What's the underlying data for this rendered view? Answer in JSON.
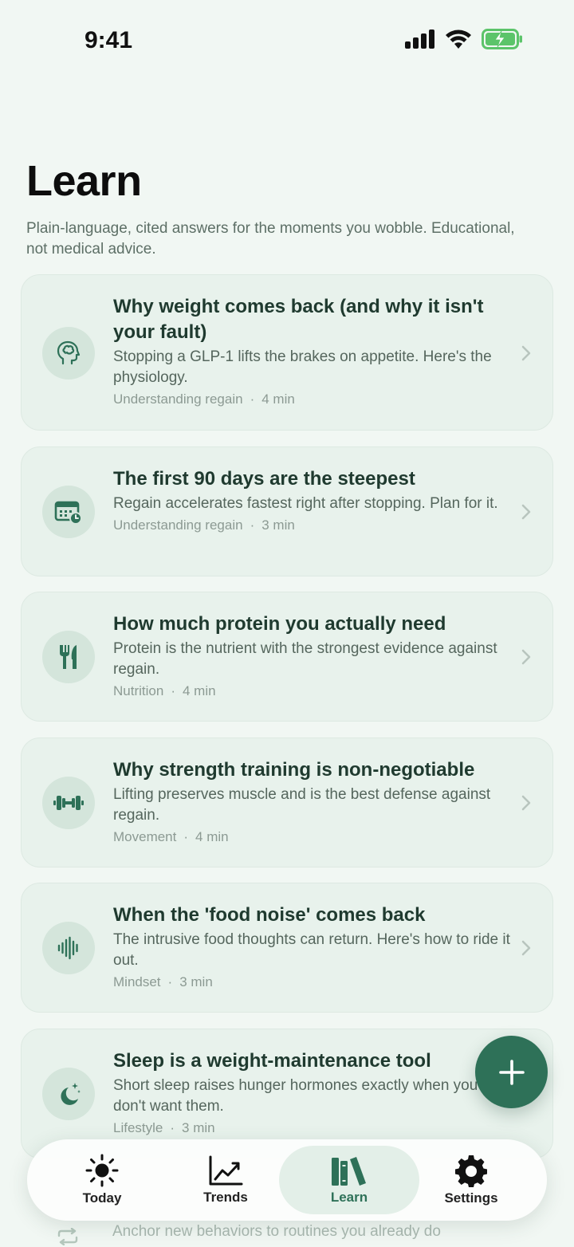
{
  "status": {
    "time": "9:41"
  },
  "header": {
    "title": "Learn",
    "subtitle": "Plain-language, cited answers for the moments you wobble. Educational, not medical advice."
  },
  "articles": [
    {
      "icon": "brain-head-icon",
      "title": "Why weight comes back (and why it isn't your fault)",
      "description": "Stopping a GLP-1 lifts the brakes on appetite. Here's the physiology.",
      "category": "Understanding regain",
      "duration": "4 min"
    },
    {
      "icon": "calendar-clock-icon",
      "title": "The first 90 days are the steepest",
      "description": "Regain accelerates fastest right after stopping. Plan for it.",
      "category": "Understanding regain",
      "duration": "3 min"
    },
    {
      "icon": "fork-knife-icon",
      "title": "How much protein you actually need",
      "description": "Protein is the nutrient with the strongest evidence against regain.",
      "category": "Nutrition",
      "duration": "4 min"
    },
    {
      "icon": "dumbbell-icon",
      "title": "Why strength training is non-negotiable",
      "description": "Lifting preserves muscle and is the best defense against regain.",
      "category": "Movement",
      "duration": "4 min"
    },
    {
      "icon": "waveform-icon",
      "title": "When the 'food noise' comes back",
      "description": "The intrusive food thoughts can return. Here's how to ride it out.",
      "category": "Mindset",
      "duration": "3 min"
    },
    {
      "icon": "moon-stars-icon",
      "title": "Sleep is a weight-maintenance tool",
      "description": "Short sleep raises hunger hormones exactly when you don't want them.",
      "category": "Lifestyle",
      "duration": "3 min"
    }
  ],
  "peek": {
    "description": "Anchor new behaviors to routines you already do",
    "icon": "repeat-icon"
  },
  "tabs": [
    {
      "label": "Today",
      "icon": "sun-icon",
      "active": false
    },
    {
      "label": "Trends",
      "icon": "chart-line-icon",
      "active": false
    },
    {
      "label": "Learn",
      "icon": "books-icon",
      "active": true
    },
    {
      "label": "Settings",
      "icon": "gear-icon",
      "active": false
    }
  ],
  "fab": {
    "icon": "plus-icon"
  },
  "colors": {
    "accent": "#2e7158",
    "card": "#e8f2ec",
    "background": "#f1f7f3"
  }
}
